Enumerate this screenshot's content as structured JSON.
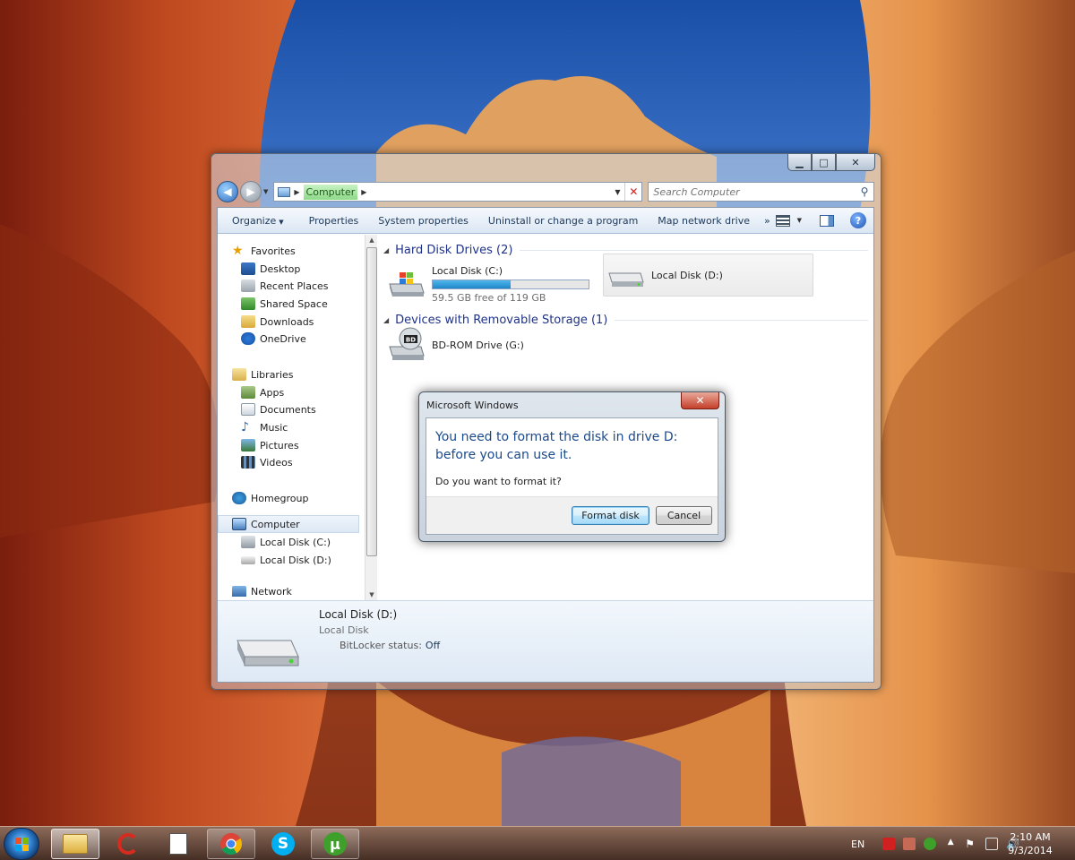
{
  "window": {
    "address": {
      "crumb": "Computer"
    },
    "search": {
      "placeholder": "Search Computer"
    },
    "caption": {
      "minimize": "▁",
      "maximize": "□",
      "close": "✕"
    },
    "toolbar": {
      "organize": "Organize",
      "properties": "Properties",
      "system_properties": "System properties",
      "uninstall": "Uninstall or change a program",
      "map_drive": "Map network drive",
      "more": "»"
    },
    "nav": {
      "favorites": "Favorites",
      "desktop": "Desktop",
      "recent": "Recent Places",
      "shared": "Shared Space",
      "downloads": "Downloads",
      "onedrive": "OneDrive",
      "libraries": "Libraries",
      "apps": "Apps",
      "documents": "Documents",
      "music": "Music",
      "pictures": "Pictures",
      "videos": "Videos",
      "homegroup": "Homegroup",
      "computer": "Computer",
      "disk_c": "Local Disk (C:)",
      "disk_d": "Local Disk (D:)",
      "network": "Network"
    },
    "content": {
      "hdd_group": "Hard Disk Drives (2)",
      "removable_group": "Devices with Removable Storage (1)",
      "drive_c": {
        "name": "Local Disk (C:)",
        "free": "59.5 GB free of 119 GB",
        "used_fraction": 0.5
      },
      "drive_d": {
        "name": "Local Disk (D:)"
      },
      "bd": {
        "name": "BD-ROM Drive (G:)",
        "badge": "BD"
      }
    },
    "details": {
      "name": "Local Disk (D:)",
      "type": "Local Disk",
      "bitlocker_label": "BitLocker status:",
      "bitlocker_value": "Off"
    }
  },
  "dialog": {
    "title": "Microsoft Windows",
    "close": "✕",
    "message": "You need to format the disk in drive D: before you can use it.",
    "question": "Do you want to format it?",
    "format_button": "Format disk",
    "cancel_button": "Cancel"
  },
  "taskbar": {
    "lang": "EN",
    "time": "2:10 AM",
    "date": "9/3/2014"
  }
}
